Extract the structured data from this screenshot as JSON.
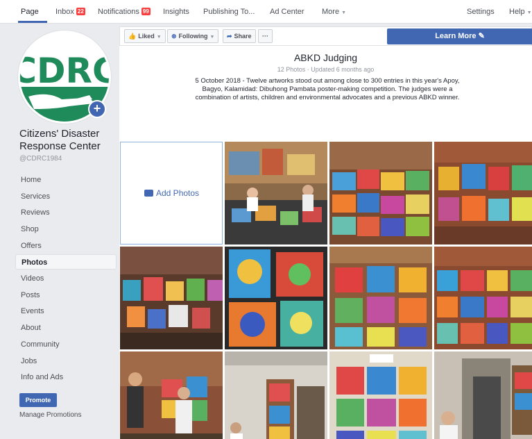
{
  "nav": {
    "page": "Page",
    "inbox": "Inbox",
    "inbox_count": "22",
    "notifications": "Notifications",
    "notifications_count": "99",
    "insights": "Insights",
    "publishing": "Publishing To...",
    "adcenter": "Ad Center",
    "more": "More",
    "settings": "Settings",
    "help": "Help"
  },
  "profile": {
    "logo_text": "CDRC",
    "name": "Citizens' Disaster Response Center",
    "handle": "@CDRC1984"
  },
  "sidebar": {
    "items": [
      {
        "label": "Home"
      },
      {
        "label": "Services"
      },
      {
        "label": "Reviews"
      },
      {
        "label": "Shop"
      },
      {
        "label": "Offers"
      },
      {
        "label": "Photos"
      },
      {
        "label": "Videos"
      },
      {
        "label": "Posts"
      },
      {
        "label": "Events"
      },
      {
        "label": "About"
      },
      {
        "label": "Community"
      },
      {
        "label": "Jobs"
      },
      {
        "label": "Info and Ads"
      }
    ],
    "active": "Photos",
    "promote": "Promote",
    "manage": "Manage Promotions"
  },
  "actions": {
    "liked": "Liked",
    "following": "Following",
    "share": "Share",
    "more": "···",
    "learn_more": "Learn More"
  },
  "album": {
    "title": "ABKD Judging",
    "meta": "12 Photos · Updated 6 months ago",
    "description": "5 October 2018 - Twelve artworks stood out among close to 300 entries in this year's Apoy, Bagyo, Kalamidad: Dibuhong Pambata poster-making competition. The judges were a combination of artists, children and environmental advocates and a previous ABKD winner.",
    "add_photos": "Add Photos"
  },
  "colors": {
    "brand": "#4267b2",
    "logo_green": "#1f8a5a",
    "badge": "#fa3e3e"
  },
  "icons": {
    "liked": "thumbs-up-icon",
    "following": "rss-icon",
    "share": "share-arrow-icon",
    "learn_more": "pencil-icon",
    "add_photos": "camera-plus-icon"
  }
}
